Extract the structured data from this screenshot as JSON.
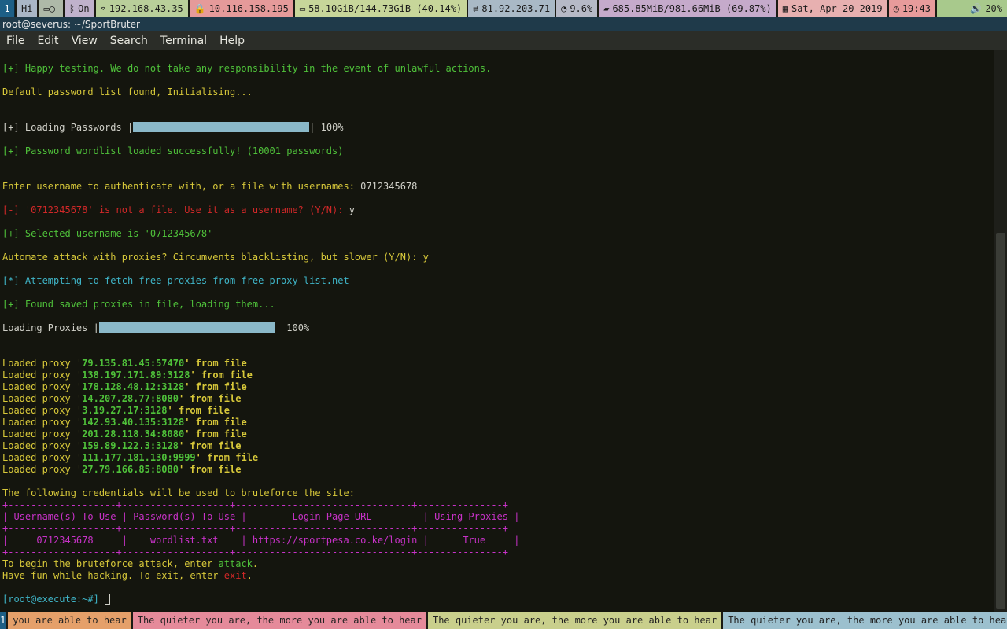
{
  "topbar": {
    "workspace": "1",
    "segments": [
      {
        "name": "greeting",
        "icon": "",
        "text": "Hi",
        "color": "#a9b6c6"
      },
      {
        "name": "battery-bluetooth",
        "icon": "▭◯",
        "text": "",
        "color": "#aeb9a8"
      },
      {
        "name": "bluetooth",
        "icon": "ᛒ",
        "text": "On",
        "color": "#c0b2cc"
      },
      {
        "name": "wifi",
        "icon": "⌔",
        "text": "192.168.43.35",
        "color": "#b9cf9a"
      },
      {
        "name": "vpn",
        "icon": "🔒",
        "text": "10.116.158.195",
        "color": "#e59a9a"
      },
      {
        "name": "disk",
        "icon": "▭",
        "text": "58.10GiB/144.73GiB (40.14%)",
        "color": "#c7d69a"
      },
      {
        "name": "network",
        "icon": "⇄",
        "text": "81.92.203.71",
        "color": "#a9b9c6"
      },
      {
        "name": "cpu",
        "icon": "◔",
        "text": "9.6%",
        "color": "#b6b9c6"
      },
      {
        "name": "memory",
        "icon": "▰",
        "text": "685.85MiB/981.66MiB (69.87%)",
        "color": "#c5aacb"
      },
      {
        "name": "date",
        "icon": "▦",
        "text": "Sat, Apr 20 2019",
        "color": "#e7b0b0"
      },
      {
        "name": "time",
        "icon": "◷",
        "text": "19:43",
        "color": "#e79b9b"
      },
      {
        "name": "volume",
        "icon": "🔊",
        "text": "20%",
        "color": "#a8c98c"
      }
    ]
  },
  "window": {
    "title": "root@severus: ~/SportBruter"
  },
  "menu": [
    "File",
    "Edit",
    "View",
    "Search",
    "Terminal",
    "Help"
  ],
  "terminal": {
    "happy": "[+] Happy testing. We do not take any responsibility in the event of unlawful actions.",
    "default_list": "Default password list found, Initialising...",
    "loading_pw_prefix": "[+] Loading Passwords |",
    "loading_pw_suffix": "| 100%",
    "pw_loaded": "[+] Password wordlist loaded successfully! (10001 passwords)",
    "enter_user_prompt": "Enter username to authenticate with, or a file with usernames: ",
    "enter_user_value": "0712345678",
    "not_file_prompt": "[-] '0712345678' is not a file. Use it as a username? (Y/N): ",
    "not_file_answer": "y",
    "selected_user": "[+] Selected username is '0712345678'",
    "proxies_prompt": "Automate attack with proxies? Circumvents blacklisting, but slower (Y/N): y",
    "fetch_proxies": "[*] Attempting to fetch free proxies from free-proxy-list.net",
    "found_saved": "[+] Found saved proxies in file, loading them...",
    "loading_px_prefix": "Loading Proxies |",
    "loading_px_suffix": "| 100%",
    "loaded_prefix": "Loaded proxy '",
    "loaded_suffix": "' from file",
    "proxies": [
      "79.135.81.45:57470",
      "138.197.171.89:3128",
      "178.128.48.12:3128",
      "14.207.28.77:8080",
      "3.19.27.17:3128",
      "142.93.40.135:3128",
      "201.28.118.34:8080",
      "159.89.122.3:3128",
      "111.177.181.130:9999",
      "27.79.166.85:8080"
    ],
    "creds_intro": "The following credentials will be used to bruteforce the site:",
    "table_border": "+-------------------+-------------------+-------------------------------+---------------+",
    "table_header": "| Username(s) To Use | Password(s) To Use |        Login Page URL         | Using Proxies |",
    "table_row": "|     0712345678     |    wordlist.txt    | https://sportpesa.co.ke/login |      True     |",
    "begin_prefix": "To begin the bruteforce attack, enter ",
    "begin_word": "attack",
    "begin_end": ".",
    "fun_prefix": "Have fun while hacking. To exit, enter ",
    "fun_word": "exit",
    "fun_end": ".",
    "prompt": "[root@execute:~#] "
  },
  "bottombar": {
    "workspace": "1",
    "segments": [
      {
        "text": "you are able to hear",
        "color": "#e5a06a"
      },
      {
        "text": "The quieter you are, the more you are able to hear",
        "color": "#e58a9a"
      },
      {
        "text": "The quieter you are, the more you are able to hear",
        "color": "#c9cf8c"
      },
      {
        "text": "The quieter you are, the more you are able to hear",
        "color": "#9cc0ce"
      }
    ]
  }
}
